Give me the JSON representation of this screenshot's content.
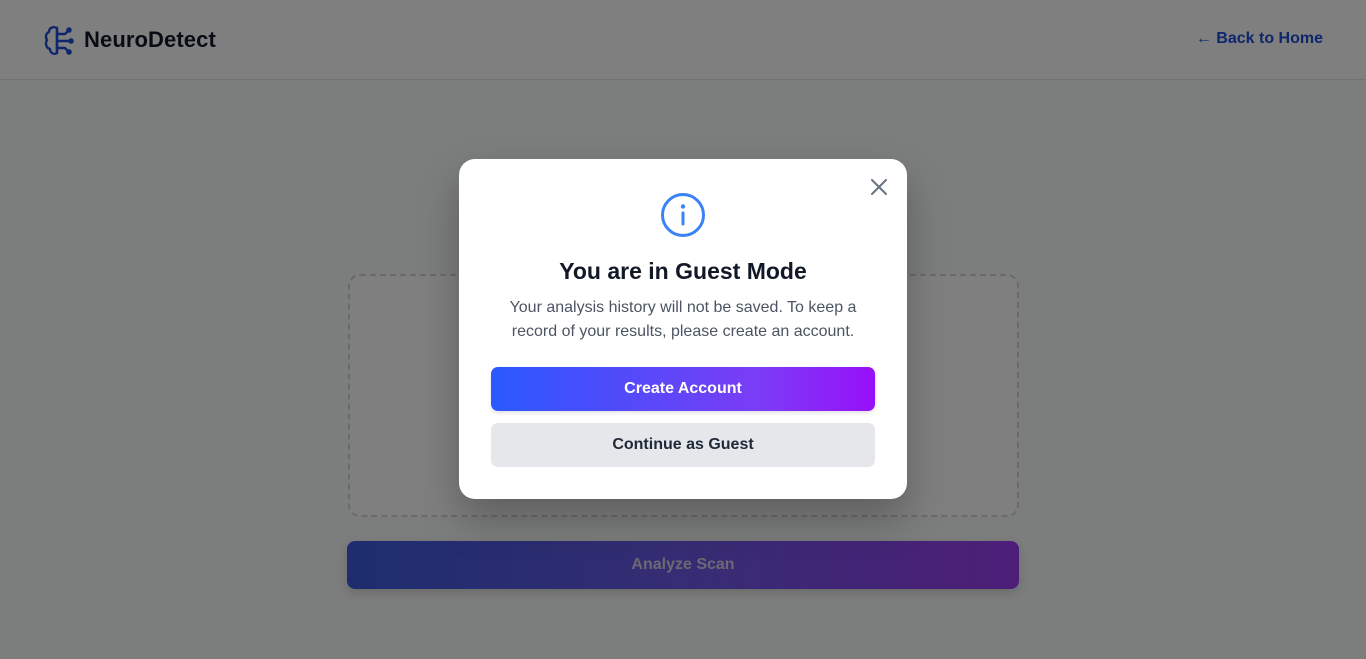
{
  "header": {
    "brand_name": "NeuroDetect",
    "brand_icon": "brain-icon",
    "back_link": "← Back to Home"
  },
  "page": {
    "analyze_button": "Analyze Scan"
  },
  "modal": {
    "icon": "info-icon",
    "title": "You are in Guest Mode",
    "message": "Your analysis history will not be saved. To keep a record of your results, please create an account.",
    "create_account_label": "Create Account",
    "continue_guest_label": "Continue as Guest",
    "close_icon": "close-icon"
  },
  "colors": {
    "brand": "#1d4ed8",
    "info": "#3b82f6",
    "gradient_start": "#2b59ff",
    "gradient_end": "#9810fa",
    "secondary_button": "#e5e7eb"
  }
}
